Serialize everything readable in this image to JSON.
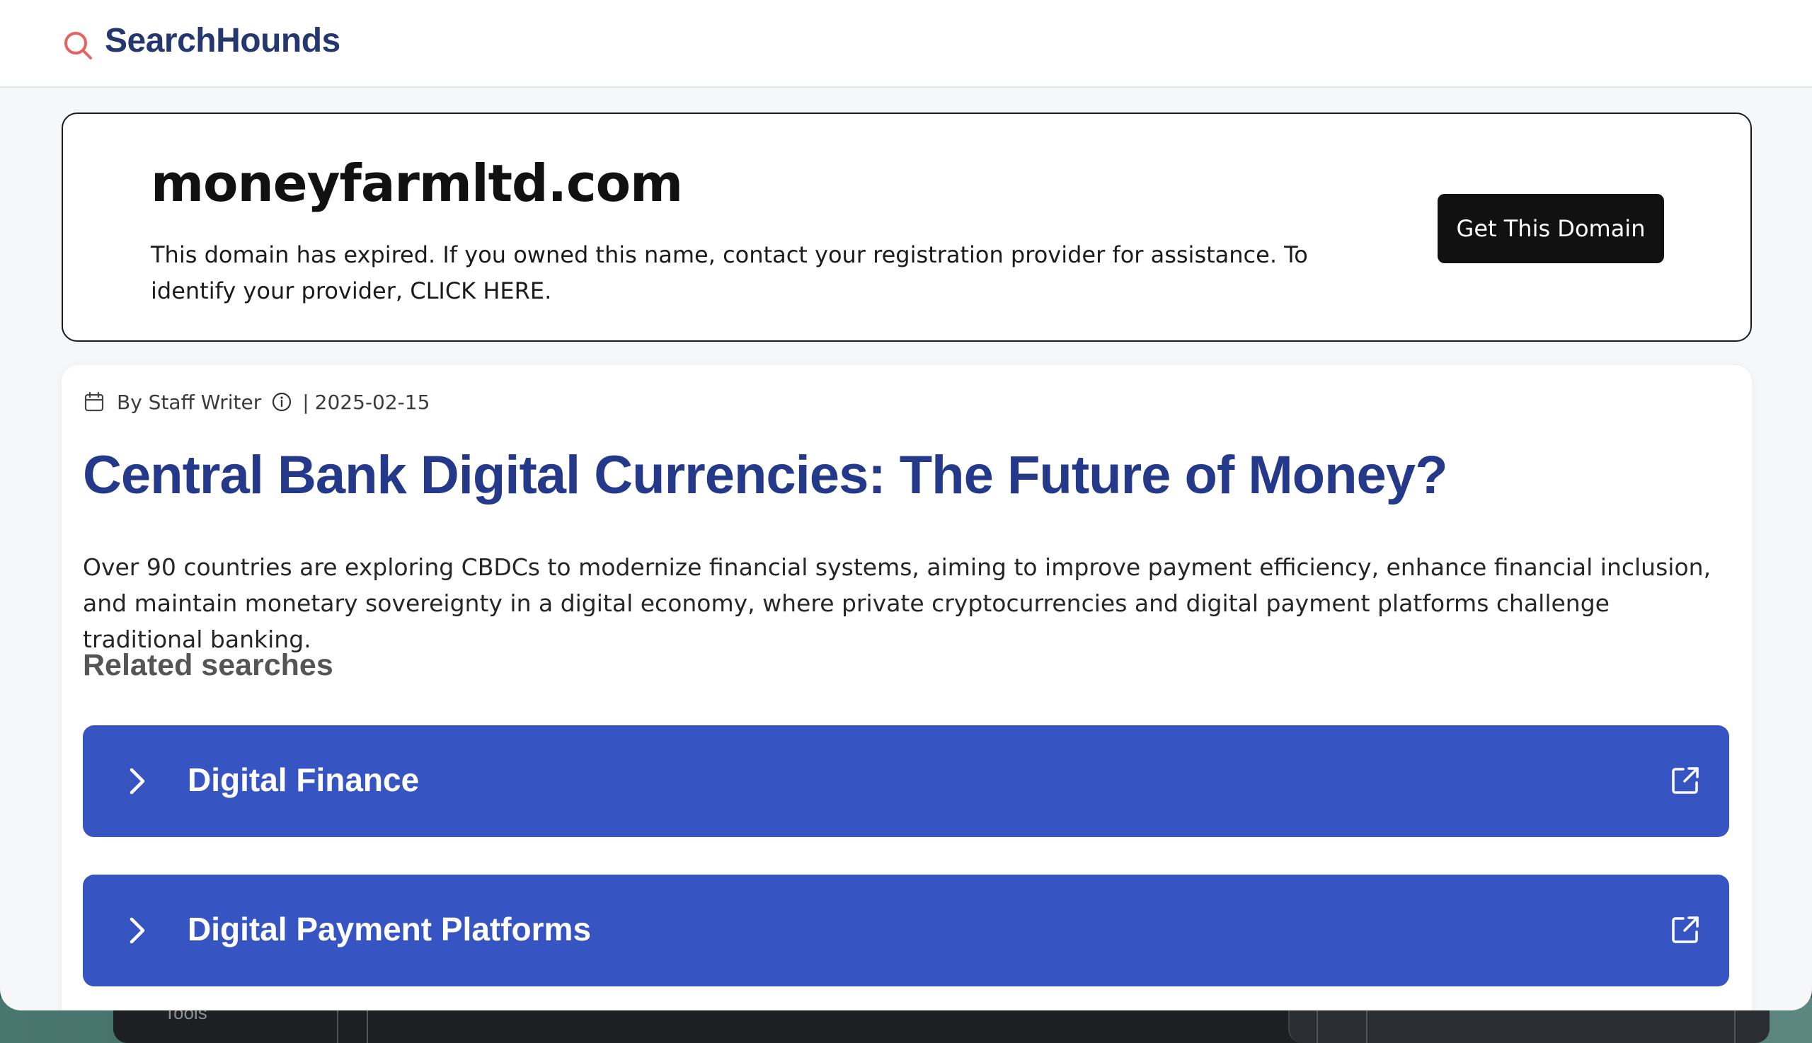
{
  "brand": {
    "name": "SearchHounds",
    "icon": "search-icon",
    "accent_color": "#e8615e",
    "text_color": "#24386f"
  },
  "domain_notice": {
    "domain": "moneyfarmltd.com",
    "message": "This domain has expired. If you owned this name, contact your registration provider for assistance. To identify your provider, CLICK HERE.",
    "button_label": "Get This Domain"
  },
  "article": {
    "author": "By Staff Writer",
    "separator": "|",
    "date": "2025-02-15",
    "title": "Central Bank Digital Currencies: The Future of Money?",
    "summary": "Over 90 countries are exploring CBDCs to modernize financial systems, aiming to improve payment efficiency, enhance financial inclusion, and maintain monetary sovereignty in a digital economy, where private cryptocurrencies and digital payment platforms challenge traditional banking.",
    "title_color": "#24398a"
  },
  "related": {
    "heading": "Related searches",
    "button_color": "#3655c2",
    "items": [
      {
        "label": "Digital Finance",
        "icon_left": "chevron-right-icon",
        "icon_right": "external-link-icon"
      },
      {
        "label": "Digital Payment Platforms",
        "icon_left": "chevron-right-icon",
        "icon_right": "external-link-icon"
      }
    ]
  },
  "background": {
    "partial_text": "Tools"
  }
}
